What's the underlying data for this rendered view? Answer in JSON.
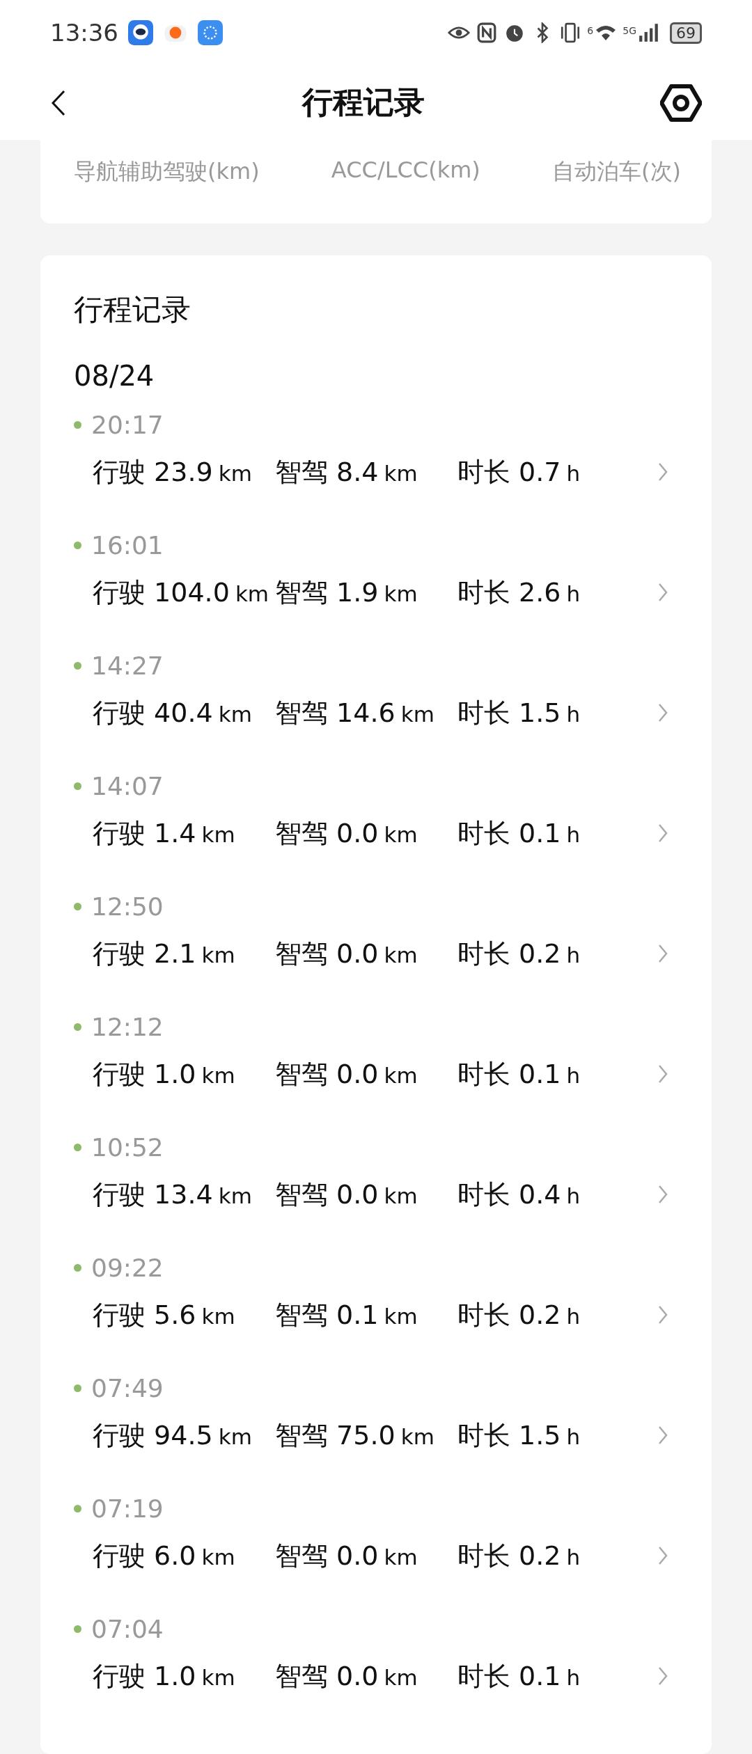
{
  "status_bar": {
    "time": "13:36",
    "network_sup": "6",
    "cell_type": "5G",
    "battery": "69"
  },
  "header": {
    "title": "行程记录"
  },
  "summary_card": {
    "labels": [
      "导航辅助驾驶(km)",
      "ACC/LCC(km)",
      "自动泊车(次)"
    ]
  },
  "trips_card": {
    "title": "行程记录",
    "date": "08/24",
    "trips": [
      {
        "time": "20:17",
        "metrics": [
          {
            "label": "行驶",
            "value": "23.9",
            "unit": "km"
          },
          {
            "label": "智驾",
            "value": "8.4",
            "unit": "km"
          },
          {
            "label": "时长",
            "value": "0.7",
            "unit": "h"
          }
        ]
      },
      {
        "time": "16:01",
        "metrics": [
          {
            "label": "行驶",
            "value": "104.0",
            "unit": "km"
          },
          {
            "label": "智驾",
            "value": "1.9",
            "unit": "km"
          },
          {
            "label": "时长",
            "value": "2.6",
            "unit": "h"
          }
        ]
      },
      {
        "time": "14:27",
        "metrics": [
          {
            "label": "行驶",
            "value": "40.4",
            "unit": "km"
          },
          {
            "label": "智驾",
            "value": "14.6",
            "unit": "km"
          },
          {
            "label": "时长",
            "value": "1.5",
            "unit": "h"
          }
        ]
      },
      {
        "time": "14:07",
        "metrics": [
          {
            "label": "行驶",
            "value": "1.4",
            "unit": "km"
          },
          {
            "label": "智驾",
            "value": "0.0",
            "unit": "km"
          },
          {
            "label": "时长",
            "value": "0.1",
            "unit": "h"
          }
        ]
      },
      {
        "time": "12:50",
        "metrics": [
          {
            "label": "行驶",
            "value": "2.1",
            "unit": "km"
          },
          {
            "label": "智驾",
            "value": "0.0",
            "unit": "km"
          },
          {
            "label": "时长",
            "value": "0.2",
            "unit": "h"
          }
        ]
      },
      {
        "time": "12:12",
        "metrics": [
          {
            "label": "行驶",
            "value": "1.0",
            "unit": "km"
          },
          {
            "label": "智驾",
            "value": "0.0",
            "unit": "km"
          },
          {
            "label": "时长",
            "value": "0.1",
            "unit": "h"
          }
        ]
      },
      {
        "time": "10:52",
        "metrics": [
          {
            "label": "行驶",
            "value": "13.4",
            "unit": "km"
          },
          {
            "label": "智驾",
            "value": "0.0",
            "unit": "km"
          },
          {
            "label": "时长",
            "value": "0.4",
            "unit": "h"
          }
        ]
      },
      {
        "time": "09:22",
        "metrics": [
          {
            "label": "行驶",
            "value": "5.6",
            "unit": "km"
          },
          {
            "label": "智驾",
            "value": "0.1",
            "unit": "km"
          },
          {
            "label": "时长",
            "value": "0.2",
            "unit": "h"
          }
        ]
      },
      {
        "time": "07:49",
        "metrics": [
          {
            "label": "行驶",
            "value": "94.5",
            "unit": "km"
          },
          {
            "label": "智驾",
            "value": "75.0",
            "unit": "km"
          },
          {
            "label": "时长",
            "value": "1.5",
            "unit": "h"
          }
        ]
      },
      {
        "time": "07:19",
        "metrics": [
          {
            "label": "行驶",
            "value": "6.0",
            "unit": "km"
          },
          {
            "label": "智驾",
            "value": "0.0",
            "unit": "km"
          },
          {
            "label": "时长",
            "value": "0.2",
            "unit": "h"
          }
        ]
      },
      {
        "time": "07:04",
        "metrics": [
          {
            "label": "行驶",
            "value": "1.0",
            "unit": "km"
          },
          {
            "label": "智驾",
            "value": "0.0",
            "unit": "km"
          },
          {
            "label": "时长",
            "value": "0.1",
            "unit": "h"
          }
        ]
      }
    ]
  }
}
